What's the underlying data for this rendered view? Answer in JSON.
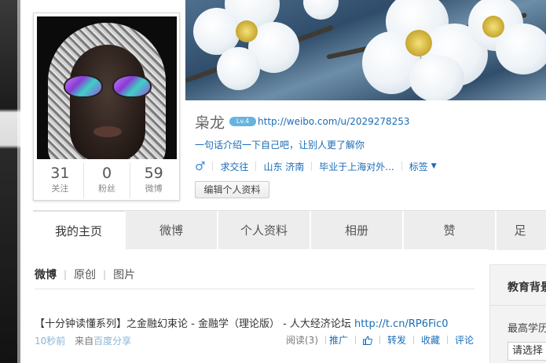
{
  "profile": {
    "name": "枭龙",
    "level": "Lv.4",
    "url": "http://weibo.com/u/2029278253",
    "intro": "一句话介绍一下自己吧，让别人更了解你",
    "gender_symbol": "♂",
    "meta_items": [
      "求交往",
      "山东 济南",
      "毕业于上海对外...",
      "标签"
    ],
    "edit_button": "编辑个人资料"
  },
  "stats": [
    {
      "num": "31",
      "label": "关注"
    },
    {
      "num": "0",
      "label": "粉丝"
    },
    {
      "num": "59",
      "label": "微博"
    }
  ],
  "tabs": [
    "我的主页",
    "微博",
    "个人资料",
    "相册",
    "赞",
    "足"
  ],
  "filter": [
    "微博",
    "原创",
    "图片"
  ],
  "post": {
    "text": "【十分钟读懂系列】之金融幻束论 - 金融学（理论版） - 人大经济论坛 ",
    "link": "http://t.cn/RP6Fic0",
    "time": "10秒前",
    "from_label": "来自",
    "source": "百度分享",
    "read": "阅读(3)",
    "promote": "推广",
    "forward": "转发",
    "favorite": "收藏",
    "comment": "评论"
  },
  "sidebar": {
    "title": "教育背景",
    "label": "最高学历",
    "select": "请选择"
  },
  "colors": {
    "link": "#1a6cb7",
    "level_badge": "#66b3e0"
  }
}
